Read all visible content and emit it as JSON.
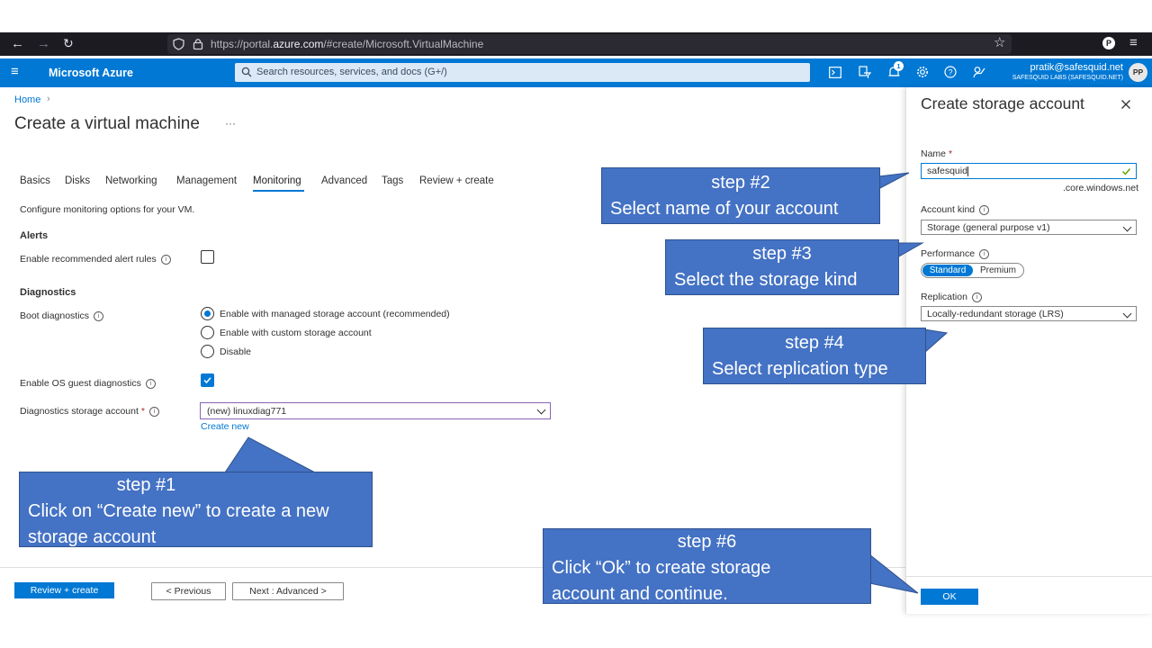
{
  "browser": {
    "url_prefix": "https://portal.",
    "url_host": "azure.com",
    "url_path": "/#create/Microsoft.VirtualMachine"
  },
  "azure": {
    "brand": "Microsoft Azure",
    "search_placeholder": "Search resources, services, and docs (G+/)",
    "notification_count": "1",
    "user_email": "pratik@safesquid.net",
    "user_org": "SAFESQUID LABS (SAFESQUID.NET)",
    "user_initials": "PP"
  },
  "main": {
    "breadcrumb_home": "Home",
    "title": "Create a virtual machine",
    "more": "···",
    "tabs": [
      "Basics",
      "Disks",
      "Networking",
      "Management",
      "Monitoring",
      "Advanced",
      "Tags",
      "Review + create"
    ],
    "active_tab": "Monitoring",
    "description": "Configure monitoring options for your VM.",
    "alerts_heading": "Alerts",
    "alert_rules_label": "Enable recommended alert rules",
    "diagnostics_heading": "Diagnostics",
    "boot_diag_label": "Boot diagnostics",
    "boot_options": [
      "Enable with managed storage account (recommended)",
      "Enable with custom storage account",
      "Disable"
    ],
    "os_guest_label": "Enable OS guest diagnostics",
    "diag_storage_label": "Diagnostics storage account",
    "required_mark": "*",
    "diag_storage_value": "(new) linuxdiag771",
    "create_new": "Create new"
  },
  "footer": {
    "review_create": "Review + create",
    "previous": "< Previous",
    "next": "Next : Advanced >"
  },
  "panel": {
    "title": "Create storage account",
    "name_label": "Name",
    "name_value": "safesquid",
    "name_suffix": ".core.windows.net",
    "account_kind_label": "Account kind",
    "account_kind_value": "Storage (general purpose v1)",
    "performance_label": "Performance",
    "perf_standard": "Standard",
    "perf_premium": "Premium",
    "replication_label": "Replication",
    "replication_value": "Locally-redundant storage (LRS)",
    "ok": "OK"
  },
  "callouts": {
    "step1_title": "step #1",
    "step1_line1": "Click on “Create new” to create a new",
    "step1_line2": "storage account",
    "step2_title": "step #2",
    "step2_line1": "Select name of your account",
    "step3_title": "step #3",
    "step3_line1": "Select  the storage kind",
    "step4_title": "step #4",
    "step4_line1": "Select replication type",
    "step6_title": "step #6",
    "step6_line1": "Click “Ok” to create storage",
    "step6_line2": "account and continue."
  },
  "colors": {
    "azure_blue": "#0078d4",
    "callout_blue": "#4472c4",
    "browser_dark": "#1c1b22"
  }
}
